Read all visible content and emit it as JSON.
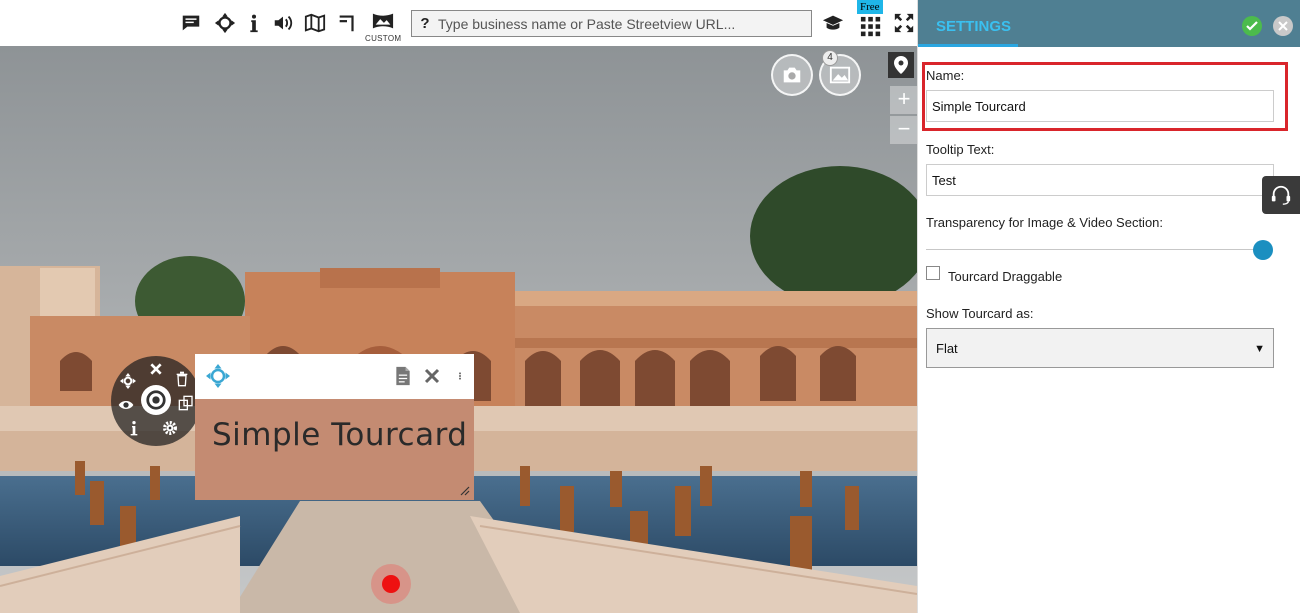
{
  "toolbar": {
    "icons": [
      "comment-icon",
      "move-icon",
      "info-icon",
      "volume-icon",
      "map-icon",
      "corner-icon",
      "custom-icon",
      "graduation-cap-icon",
      "grid-icon",
      "fullscreen-icon"
    ],
    "custom_label": "CUSTOM",
    "search": {
      "prefix": "?",
      "placeholder": "Type business name or Paste Streetview URL..."
    },
    "free_badge": "Free"
  },
  "viewer": {
    "photo_count": "4",
    "zoom_in": "+",
    "zoom_out": "−",
    "tourcard": {
      "title": "Simple Tourcard",
      "background": "#c48b72"
    },
    "record_color": "#ee1111"
  },
  "settings": {
    "tab_label": "SETTINGS",
    "header_color": "#4f7f92",
    "accent": "#2aa6e0",
    "name_label": "Name:",
    "name_value": "Simple Tourcard",
    "tooltip_label": "Tooltip Text:",
    "tooltip_value": "Test",
    "transparency_label": "Transparency for Image & Video Section:",
    "transparency_value": 1.0,
    "draggable_label": "Tourcard Draggable",
    "draggable_checked": false,
    "show_as_label": "Show Tourcard as:",
    "show_as_value": "Flat"
  }
}
